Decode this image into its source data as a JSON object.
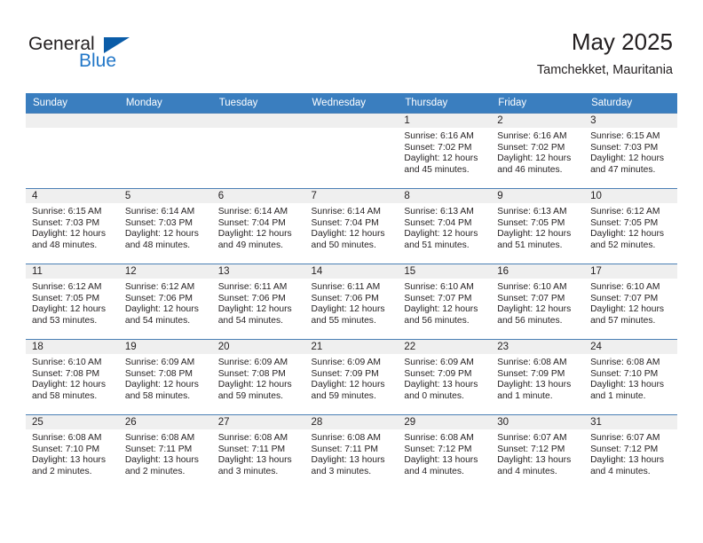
{
  "brand": {
    "name_part1": "General",
    "name_part2": "Blue",
    "accent_color": "#2277c8",
    "triangle_color": "#0a5ca8"
  },
  "header": {
    "title": "May 2025",
    "subtitle": "Tamchekket, Mauritania"
  },
  "theme": {
    "header_row_bg": "#3a7ebf",
    "daynum_band_bg": "#efefef",
    "text_color": "#231f20"
  },
  "weekday_headers": [
    "Sunday",
    "Monday",
    "Tuesday",
    "Wednesday",
    "Thursday",
    "Friday",
    "Saturday"
  ],
  "weeks": [
    [
      {
        "day": "",
        "empty": true,
        "sunrise": "",
        "sunset": "",
        "daylight_line1": "",
        "daylight_line2": ""
      },
      {
        "day": "",
        "empty": true,
        "sunrise": "",
        "sunset": "",
        "daylight_line1": "",
        "daylight_line2": ""
      },
      {
        "day": "",
        "empty": true,
        "sunrise": "",
        "sunset": "",
        "daylight_line1": "",
        "daylight_line2": ""
      },
      {
        "day": "",
        "empty": true,
        "sunrise": "",
        "sunset": "",
        "daylight_line1": "",
        "daylight_line2": ""
      },
      {
        "day": "1",
        "empty": false,
        "sunrise": "Sunrise: 6:16 AM",
        "sunset": "Sunset: 7:02 PM",
        "daylight_line1": "Daylight: 12 hours",
        "daylight_line2": "and 45 minutes."
      },
      {
        "day": "2",
        "empty": false,
        "sunrise": "Sunrise: 6:16 AM",
        "sunset": "Sunset: 7:02 PM",
        "daylight_line1": "Daylight: 12 hours",
        "daylight_line2": "and 46 minutes."
      },
      {
        "day": "3",
        "empty": false,
        "sunrise": "Sunrise: 6:15 AM",
        "sunset": "Sunset: 7:03 PM",
        "daylight_line1": "Daylight: 12 hours",
        "daylight_line2": "and 47 minutes."
      }
    ],
    [
      {
        "day": "4",
        "empty": false,
        "sunrise": "Sunrise: 6:15 AM",
        "sunset": "Sunset: 7:03 PM",
        "daylight_line1": "Daylight: 12 hours",
        "daylight_line2": "and 48 minutes."
      },
      {
        "day": "5",
        "empty": false,
        "sunrise": "Sunrise: 6:14 AM",
        "sunset": "Sunset: 7:03 PM",
        "daylight_line1": "Daylight: 12 hours",
        "daylight_line2": "and 48 minutes."
      },
      {
        "day": "6",
        "empty": false,
        "sunrise": "Sunrise: 6:14 AM",
        "sunset": "Sunset: 7:04 PM",
        "daylight_line1": "Daylight: 12 hours",
        "daylight_line2": "and 49 minutes."
      },
      {
        "day": "7",
        "empty": false,
        "sunrise": "Sunrise: 6:14 AM",
        "sunset": "Sunset: 7:04 PM",
        "daylight_line1": "Daylight: 12 hours",
        "daylight_line2": "and 50 minutes."
      },
      {
        "day": "8",
        "empty": false,
        "sunrise": "Sunrise: 6:13 AM",
        "sunset": "Sunset: 7:04 PM",
        "daylight_line1": "Daylight: 12 hours",
        "daylight_line2": "and 51 minutes."
      },
      {
        "day": "9",
        "empty": false,
        "sunrise": "Sunrise: 6:13 AM",
        "sunset": "Sunset: 7:05 PM",
        "daylight_line1": "Daylight: 12 hours",
        "daylight_line2": "and 51 minutes."
      },
      {
        "day": "10",
        "empty": false,
        "sunrise": "Sunrise: 6:12 AM",
        "sunset": "Sunset: 7:05 PM",
        "daylight_line1": "Daylight: 12 hours",
        "daylight_line2": "and 52 minutes."
      }
    ],
    [
      {
        "day": "11",
        "empty": false,
        "sunrise": "Sunrise: 6:12 AM",
        "sunset": "Sunset: 7:05 PM",
        "daylight_line1": "Daylight: 12 hours",
        "daylight_line2": "and 53 minutes."
      },
      {
        "day": "12",
        "empty": false,
        "sunrise": "Sunrise: 6:12 AM",
        "sunset": "Sunset: 7:06 PM",
        "daylight_line1": "Daylight: 12 hours",
        "daylight_line2": "and 54 minutes."
      },
      {
        "day": "13",
        "empty": false,
        "sunrise": "Sunrise: 6:11 AM",
        "sunset": "Sunset: 7:06 PM",
        "daylight_line1": "Daylight: 12 hours",
        "daylight_line2": "and 54 minutes."
      },
      {
        "day": "14",
        "empty": false,
        "sunrise": "Sunrise: 6:11 AM",
        "sunset": "Sunset: 7:06 PM",
        "daylight_line1": "Daylight: 12 hours",
        "daylight_line2": "and 55 minutes."
      },
      {
        "day": "15",
        "empty": false,
        "sunrise": "Sunrise: 6:10 AM",
        "sunset": "Sunset: 7:07 PM",
        "daylight_line1": "Daylight: 12 hours",
        "daylight_line2": "and 56 minutes."
      },
      {
        "day": "16",
        "empty": false,
        "sunrise": "Sunrise: 6:10 AM",
        "sunset": "Sunset: 7:07 PM",
        "daylight_line1": "Daylight: 12 hours",
        "daylight_line2": "and 56 minutes."
      },
      {
        "day": "17",
        "empty": false,
        "sunrise": "Sunrise: 6:10 AM",
        "sunset": "Sunset: 7:07 PM",
        "daylight_line1": "Daylight: 12 hours",
        "daylight_line2": "and 57 minutes."
      }
    ],
    [
      {
        "day": "18",
        "empty": false,
        "sunrise": "Sunrise: 6:10 AM",
        "sunset": "Sunset: 7:08 PM",
        "daylight_line1": "Daylight: 12 hours",
        "daylight_line2": "and 58 minutes."
      },
      {
        "day": "19",
        "empty": false,
        "sunrise": "Sunrise: 6:09 AM",
        "sunset": "Sunset: 7:08 PM",
        "daylight_line1": "Daylight: 12 hours",
        "daylight_line2": "and 58 minutes."
      },
      {
        "day": "20",
        "empty": false,
        "sunrise": "Sunrise: 6:09 AM",
        "sunset": "Sunset: 7:08 PM",
        "daylight_line1": "Daylight: 12 hours",
        "daylight_line2": "and 59 minutes."
      },
      {
        "day": "21",
        "empty": false,
        "sunrise": "Sunrise: 6:09 AM",
        "sunset": "Sunset: 7:09 PM",
        "daylight_line1": "Daylight: 12 hours",
        "daylight_line2": "and 59 minutes."
      },
      {
        "day": "22",
        "empty": false,
        "sunrise": "Sunrise: 6:09 AM",
        "sunset": "Sunset: 7:09 PM",
        "daylight_line1": "Daylight: 13 hours",
        "daylight_line2": "and 0 minutes."
      },
      {
        "day": "23",
        "empty": false,
        "sunrise": "Sunrise: 6:08 AM",
        "sunset": "Sunset: 7:09 PM",
        "daylight_line1": "Daylight: 13 hours",
        "daylight_line2": "and 1 minute."
      },
      {
        "day": "24",
        "empty": false,
        "sunrise": "Sunrise: 6:08 AM",
        "sunset": "Sunset: 7:10 PM",
        "daylight_line1": "Daylight: 13 hours",
        "daylight_line2": "and 1 minute."
      }
    ],
    [
      {
        "day": "25",
        "empty": false,
        "sunrise": "Sunrise: 6:08 AM",
        "sunset": "Sunset: 7:10 PM",
        "daylight_line1": "Daylight: 13 hours",
        "daylight_line2": "and 2 minutes."
      },
      {
        "day": "26",
        "empty": false,
        "sunrise": "Sunrise: 6:08 AM",
        "sunset": "Sunset: 7:11 PM",
        "daylight_line1": "Daylight: 13 hours",
        "daylight_line2": "and 2 minutes."
      },
      {
        "day": "27",
        "empty": false,
        "sunrise": "Sunrise: 6:08 AM",
        "sunset": "Sunset: 7:11 PM",
        "daylight_line1": "Daylight: 13 hours",
        "daylight_line2": "and 3 minutes."
      },
      {
        "day": "28",
        "empty": false,
        "sunrise": "Sunrise: 6:08 AM",
        "sunset": "Sunset: 7:11 PM",
        "daylight_line1": "Daylight: 13 hours",
        "daylight_line2": "and 3 minutes."
      },
      {
        "day": "29",
        "empty": false,
        "sunrise": "Sunrise: 6:08 AM",
        "sunset": "Sunset: 7:12 PM",
        "daylight_line1": "Daylight: 13 hours",
        "daylight_line2": "and 4 minutes."
      },
      {
        "day": "30",
        "empty": false,
        "sunrise": "Sunrise: 6:07 AM",
        "sunset": "Sunset: 7:12 PM",
        "daylight_line1": "Daylight: 13 hours",
        "daylight_line2": "and 4 minutes."
      },
      {
        "day": "31",
        "empty": false,
        "sunrise": "Sunrise: 6:07 AM",
        "sunset": "Sunset: 7:12 PM",
        "daylight_line1": "Daylight: 13 hours",
        "daylight_line2": "and 4 minutes."
      }
    ]
  ]
}
